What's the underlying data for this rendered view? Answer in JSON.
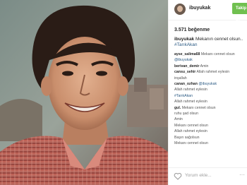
{
  "post": {
    "username": "ibuyukak",
    "follow_label": "Takip Et",
    "likes": "3.571 beğenme",
    "caption_user": "ibuyukak",
    "caption_text": "Mekanın cennet olsun..",
    "caption_hashtag": "#TarıkAkan"
  },
  "comments": [
    {
      "user": "ayse_salima68",
      "text": "Mekanı cennet olsun"
    },
    {
      "user": "",
      "text": "",
      "link": "@ibuyukak"
    },
    {
      "user": "berivan_demir",
      "text": "Amin"
    },
    {
      "user": "cansu_sehir",
      "text": "Allah rahmet eylesin"
    },
    {
      "user": "",
      "text": "inşallah"
    },
    {
      "user": "canan_ozhan",
      "text": "",
      "link": "@ibuyukak"
    },
    {
      "user": "",
      "text": "Allah rahmet eylesin"
    },
    {
      "user": "",
      "text": "",
      "link": "#TarıkAkan"
    },
    {
      "user": "",
      "text": "Allah rahmet eylesin"
    },
    {
      "user": "gul.",
      "text": "Mekanı cennet olsun"
    },
    {
      "user": "",
      "text": "ruhu şad olsun"
    },
    {
      "user": "",
      "text": "Amin"
    },
    {
      "user": "",
      "text": "Mekanı cennet olsun"
    },
    {
      "user": "",
      "text": "Allah rahmet eylesin"
    },
    {
      "user": "",
      "text": "Başın sağolsun"
    },
    {
      "user": "",
      "text": "Mekanı cennet olsun"
    }
  ],
  "footer": {
    "add_comment_placeholder": "Yorum ekle...",
    "more_label": "···"
  },
  "colors": {
    "follow_button": "#70c050",
    "hashtag": "#2b5a83",
    "text": "#262626"
  },
  "icons": {
    "like": "heart-outline-icon",
    "more": "ellipsis-icon"
  }
}
